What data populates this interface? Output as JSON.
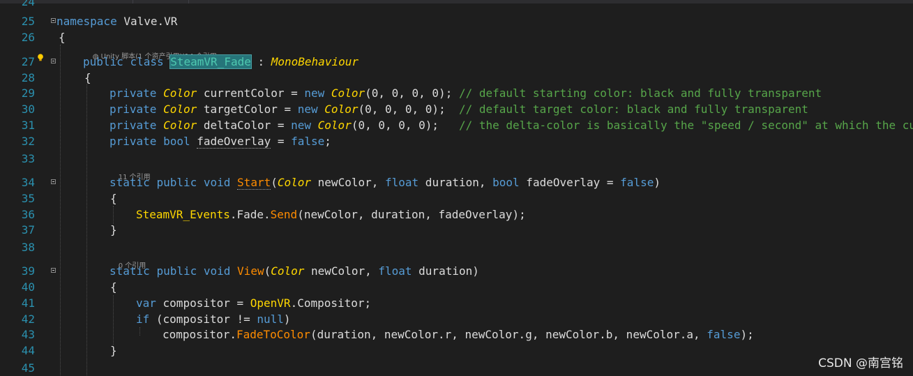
{
  "editor": {
    "lines": [
      {
        "n": "24"
      },
      {
        "n": "25",
        "code": "namespace Valve.VR"
      },
      {
        "n": "26",
        "code": "{"
      },
      {
        "n": "27",
        "lens": "Unity 脚本(1 个资产引用)|14 个引用",
        "code": "public class SteamVR_Fade : MonoBehaviour"
      },
      {
        "n": "28",
        "code": "{"
      },
      {
        "n": "29",
        "code": "private Color currentColor = new Color(0, 0, 0, 0); // default starting color: black and fully transparent"
      },
      {
        "n": "30",
        "code": "private Color targetColor = new Color(0, 0, 0, 0);  // default target color: black and fully transparent"
      },
      {
        "n": "31",
        "code": "private Color deltaColor = new Color(0, 0, 0, 0);   // the delta-color is basically the \"speed / second\" at which the curr"
      },
      {
        "n": "32",
        "code": "private bool fadeOverlay = false;"
      },
      {
        "n": "33"
      },
      {
        "n": "34",
        "lens": "11 个引用",
        "code": "static public void Start(Color newColor, float duration, bool fadeOverlay = false)"
      },
      {
        "n": "35",
        "code": "{"
      },
      {
        "n": "36",
        "code": "SteamVR_Events.Fade.Send(newColor, duration, fadeOverlay);"
      },
      {
        "n": "37",
        "code": "}"
      },
      {
        "n": "38"
      },
      {
        "n": "39",
        "lens": "0 个引用",
        "code": "static public void View(Color newColor, float duration)"
      },
      {
        "n": "40",
        "code": "{"
      },
      {
        "n": "41",
        "code": "var compositor = OpenVR.Compositor;"
      },
      {
        "n": "42",
        "code": "if (compositor != null)"
      },
      {
        "n": "43",
        "code": "compositor.FadeToColor(duration, newColor.r, newColor.g, newColor.b, newColor.a, false);"
      },
      {
        "n": "44",
        "code": "}"
      },
      {
        "n": "45"
      }
    ]
  },
  "tokens": {
    "l25": {
      "kw": "namespace",
      "name": "Valve.VR"
    },
    "l27": {
      "public": "public",
      "class": "class",
      "name": "SteamVR_Fade",
      "colon": " : ",
      "base": "MonoBehaviour"
    },
    "l29": {
      "private": "private",
      "type": "Color",
      "ident": " currentColor = ",
      "new": "new",
      "ctor": "Color",
      "args": "(0, 0, 0, 0); ",
      "comment": "// default starting color: black and fully transparent"
    },
    "l30": {
      "private": "private",
      "type": "Color",
      "ident": " targetColor = ",
      "new": "new",
      "ctor": "Color",
      "args": "(0, 0, 0, 0);  ",
      "comment": "// default target color: black and fully transparent"
    },
    "l31": {
      "private": "private",
      "type": "Color",
      "ident": " deltaColor = ",
      "new": "new",
      "ctor": "Color",
      "args": "(0, 0, 0, 0);   ",
      "comment": "// the delta-color is basically the \"speed / second\" at which the curr"
    },
    "l32": {
      "private": "private",
      "bool": "bool",
      "field": "fadeOverlay",
      "rest": " = ",
      "false": "false",
      "semi": ";"
    },
    "l34": {
      "static": "static",
      "public": "public",
      "void": "void",
      "method": "Start",
      "p1": "(",
      "type": "Color",
      "a1": " newColor, ",
      "float": "float",
      "a2": " duration, ",
      "bool": "bool",
      "a3": " fadeOverlay = ",
      "false": "false",
      "p2": ")"
    },
    "l36": {
      "cls": "SteamVR_Events",
      "dot1": ".Fade.",
      "method": "Send",
      "args": "(newColor, duration, fadeOverlay);"
    },
    "l39": {
      "static": "static",
      "public": "public",
      "void": "void",
      "method": "View",
      "p1": "(",
      "type": "Color",
      "a1": " newColor, ",
      "float": "float",
      "a2": " duration)"
    },
    "l41": {
      "var": "var",
      "ident": " compositor = ",
      "cls": "OpenVR",
      "rest": ".Compositor;"
    },
    "l42": {
      "if": "if",
      "ident": " (compositor != ",
      "null": "null",
      "p": ")"
    },
    "l43": {
      "obj": "compositor.",
      "method": "FadeToColor",
      "args": "(duration, newColor.r, newColor.g, newColor.b, newColor.a, ",
      "false": "false",
      "end": ");"
    },
    "brace_open": "{",
    "brace_close": "}"
  },
  "watermark": "CSDN @南宫铭",
  "icons": {
    "bulb": "lightbulb-icon",
    "fold": "collapse-icon",
    "lens": "codelens-icon"
  }
}
